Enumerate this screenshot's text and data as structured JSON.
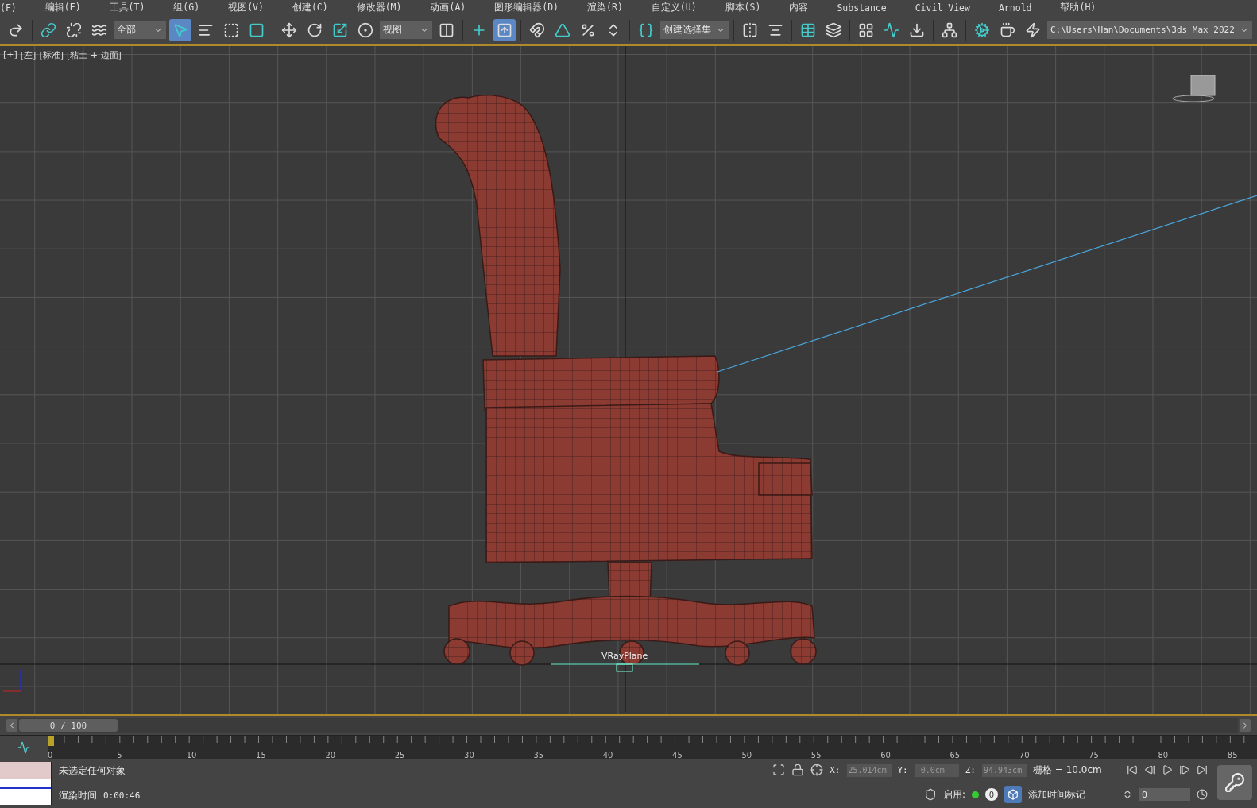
{
  "menu": [
    "(F)",
    "编辑(E)",
    "工具(T)",
    "组(G)",
    "视图(V)",
    "创建(C)",
    "修改器(M)",
    "动画(A)",
    "图形编辑器(D)",
    "渲染(R)",
    "自定义(U)",
    "脚本(S)",
    "内容",
    "Substance",
    "Civil View",
    "Arnold",
    "帮助(H)"
  ],
  "toolbar": [
    {
      "kind": "button",
      "selected": false
    },
    {
      "kind": "sep"
    },
    {
      "kind": "button",
      "selected": false
    },
    {
      "kind": "button",
      "selected": false
    },
    {
      "kind": "button",
      "selected": false
    },
    {
      "kind": "dropdown",
      "value": "全部"
    },
    {
      "kind": "button",
      "selected": true
    },
    {
      "kind": "button",
      "selected": false
    },
    {
      "kind": "button",
      "selected": false
    },
    {
      "kind": "button",
      "selected": false
    },
    {
      "kind": "sep"
    },
    {
      "kind": "button",
      "selected": false
    },
    {
      "kind": "button",
      "selected": false
    },
    {
      "kind": "button",
      "selected": false
    },
    {
      "kind": "button",
      "selected": false
    },
    {
      "kind": "dropdown",
      "value": "视图"
    },
    {
      "kind": "button",
      "selected": false
    },
    {
      "kind": "sep"
    },
    {
      "kind": "button",
      "selected": false
    },
    {
      "kind": "button",
      "selected": true
    },
    {
      "kind": "sep"
    },
    {
      "kind": "button",
      "selected": false
    },
    {
      "kind": "button",
      "selected": false
    },
    {
      "kind": "button",
      "selected": false
    },
    {
      "kind": "button",
      "selected": false
    },
    {
      "kind": "sep"
    },
    {
      "kind": "button",
      "selected": false
    },
    {
      "kind": "dropdown",
      "value": "创建选择集"
    },
    {
      "kind": "sep"
    },
    {
      "kind": "button",
      "selected": false
    },
    {
      "kind": "button",
      "selected": false
    },
    {
      "kind": "sep"
    },
    {
      "kind": "button",
      "selected": false
    },
    {
      "kind": "button",
      "selected": false
    },
    {
      "kind": "sep"
    },
    {
      "kind": "button",
      "selected": false
    },
    {
      "kind": "button",
      "selected": false
    },
    {
      "kind": "button",
      "selected": false
    },
    {
      "kind": "sep"
    },
    {
      "kind": "button",
      "selected": false
    },
    {
      "kind": "sep"
    },
    {
      "kind": "button",
      "selected": false
    },
    {
      "kind": "button",
      "selected": false
    },
    {
      "kind": "button",
      "selected": false
    },
    {
      "kind": "path",
      "value": "C:\\Users\\Han\\Documents\\3ds Max 2022"
    }
  ],
  "viewport": {
    "labels": [
      "[+]",
      "[左]",
      "[标准]",
      "[粘土 + 边面]"
    ],
    "object_label": "VRayPlane"
  },
  "time_slider": {
    "text": "0 / 100",
    "level": 0
  },
  "ruler": [
    "0",
    "5",
    "10",
    "15",
    "20",
    "25",
    "30",
    "35",
    "40",
    "45",
    "50",
    "55",
    "60",
    "65",
    "70",
    "75",
    "80",
    "85"
  ],
  "status": {
    "selection": "未选定任何对象",
    "render_label": "渲染时间",
    "render_time": "0:00:46",
    "x_label": "X:",
    "x": "25.014cm",
    "y_label": "Y:",
    "y": "-0.0cm",
    "z_label": "Z:",
    "z": "94.943cm",
    "grid": "栅格 = 10.0cm",
    "enable_label": "启用:",
    "enable_count": "0",
    "add_tag": "添加时间标记",
    "frame": "0"
  }
}
